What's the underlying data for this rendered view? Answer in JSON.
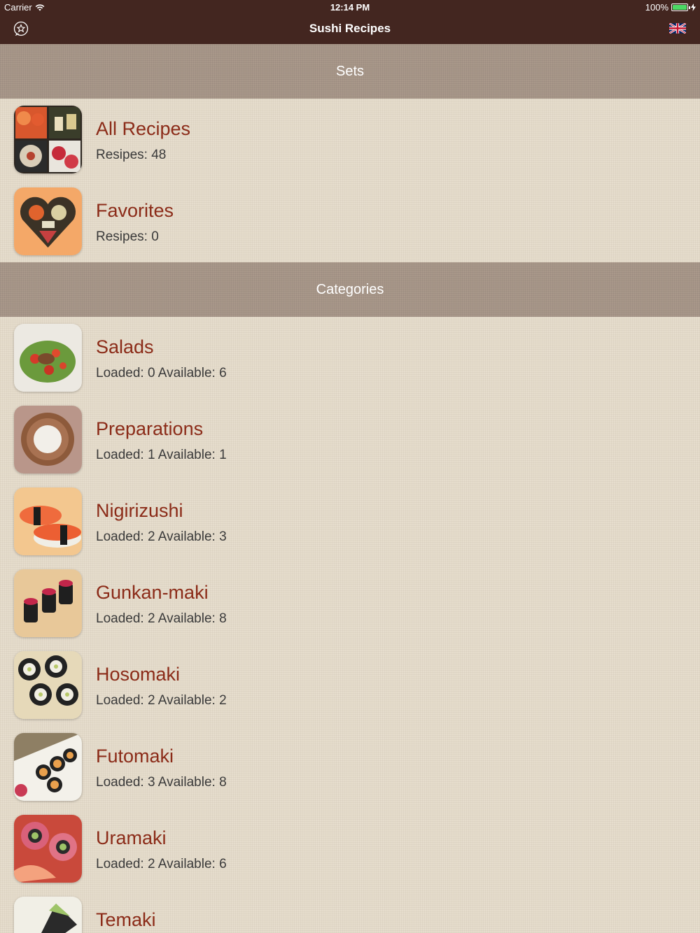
{
  "status_bar": {
    "carrier": "Carrier",
    "time": "12:14 PM",
    "battery": "100%"
  },
  "nav": {
    "title": "Sushi Recipes",
    "left_icon": "star-icon",
    "right_icon": "uk-flag-icon"
  },
  "sections": {
    "sets": "Sets",
    "categories": "Categories"
  },
  "sets": [
    {
      "title": "All Recipes",
      "subtitle": "Resipes: 48",
      "icon": "sushi-collage-thumbnail"
    },
    {
      "title": "Favorites",
      "subtitle": "Resipes: 0",
      "icon": "sushi-heart-thumbnail"
    }
  ],
  "categories": [
    {
      "title": "Salads",
      "subtitle": "Loaded: 0 Available: 6",
      "icon": "salad-thumbnail"
    },
    {
      "title": "Preparations",
      "subtitle": "Loaded: 1 Available: 1",
      "icon": "rice-bowl-thumbnail"
    },
    {
      "title": "Nigirizushi",
      "subtitle": "Loaded: 2 Available: 3",
      "icon": "nigiri-thumbnail"
    },
    {
      "title": "Gunkan-maki",
      "subtitle": "Loaded: 2 Available: 8",
      "icon": "gunkan-thumbnail"
    },
    {
      "title": "Hosomaki",
      "subtitle": "Loaded: 2 Available: 2",
      "icon": "hosomaki-thumbnail"
    },
    {
      "title": "Futomaki",
      "subtitle": "Loaded: 3 Available: 8",
      "icon": "futomaki-thumbnail"
    },
    {
      "title": "Uramaki",
      "subtitle": "Loaded: 2 Available: 6",
      "icon": "uramaki-thumbnail"
    },
    {
      "title": "Temaki",
      "subtitle": "",
      "icon": "temaki-thumbnail"
    }
  ],
  "colors": {
    "nav_bar": "#432620",
    "section_header": "#a9988a",
    "row_title": "#8b2b18",
    "battery": "#4cd964"
  }
}
